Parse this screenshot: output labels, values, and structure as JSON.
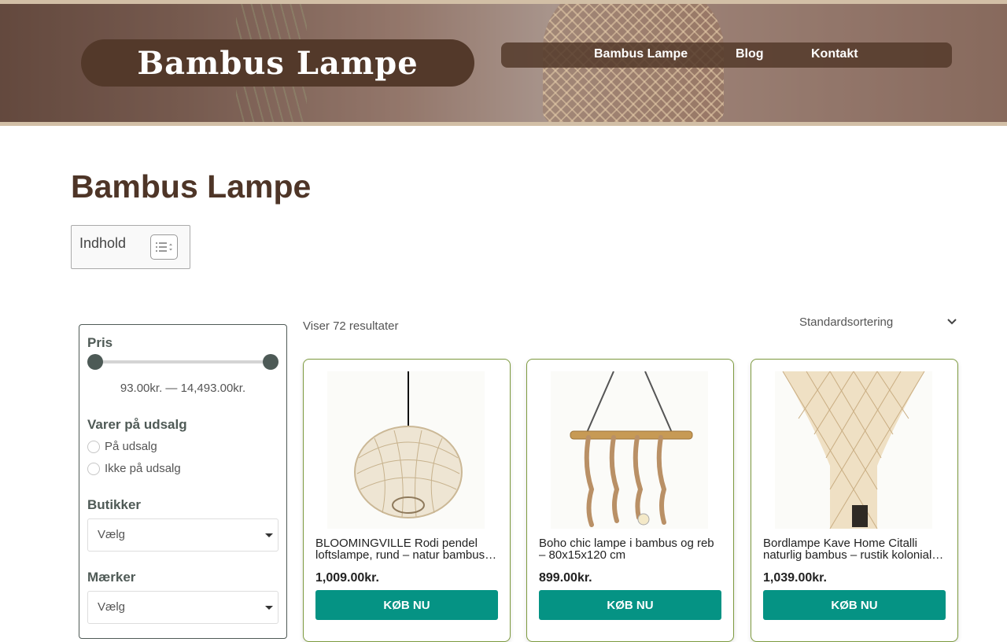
{
  "header": {
    "logo": "Bambus Lampe",
    "nav": [
      "Bambus Lampe",
      "Blog",
      "Kontakt"
    ]
  },
  "page": {
    "title": "Bambus Lampe",
    "toc_label": "Indhold"
  },
  "filters": {
    "price": {
      "title": "Pris",
      "range_text": "93.00kr. — 14,493.00kr.",
      "min_fraction": 0.0,
      "max_fraction": 1.0
    },
    "sale": {
      "title": "Varer på udsalg",
      "options": [
        "På udsalg",
        "Ikke på udsalg"
      ]
    },
    "stores": {
      "title": "Butikker",
      "selected": "Vælg"
    },
    "brands": {
      "title": "Mærker",
      "selected": "Vælg"
    }
  },
  "results": {
    "count_text": "Viser 72 resultater",
    "sort_selected": "Standardsortering"
  },
  "products": [
    {
      "title": "BLOOMINGVILLE Rodi pendel loftslampe, rund – natur bambus og metal",
      "price": "1,009.00kr.",
      "button": "KØB NU"
    },
    {
      "title": "Boho chic lampe i bambus og reb – 80x15x120 cm",
      "price": "899.00kr.",
      "button": "KØB NU"
    },
    {
      "title": "Bordlampe Kave Home Citalli naturlig bambus – rustik kolonial stil",
      "price": "1,039.00kr.",
      "button": "KØB NU"
    }
  ],
  "colors": {
    "brand_brown": "#53392a",
    "accent_teal": "#059384",
    "card_border": "#7d9a3f"
  }
}
